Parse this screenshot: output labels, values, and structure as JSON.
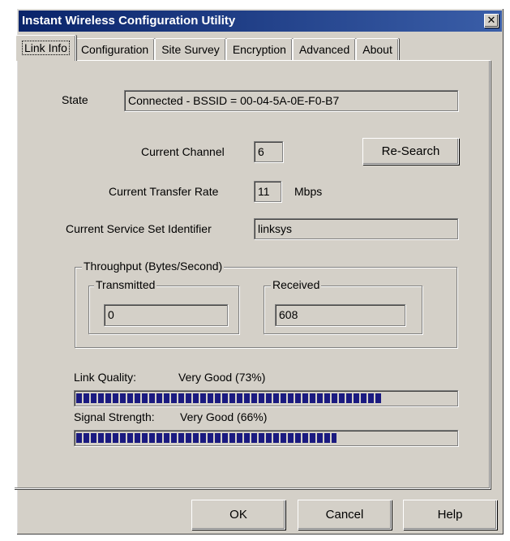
{
  "window": {
    "title": "Instant Wireless Configuration Utility",
    "close_glyph": "✕"
  },
  "tabs": [
    {
      "label": "Link Info",
      "active": true
    },
    {
      "label": "Configuration",
      "active": false
    },
    {
      "label": "Site Survey",
      "active": false
    },
    {
      "label": "Encryption",
      "active": false
    },
    {
      "label": "Advanced",
      "active": false
    },
    {
      "label": "About",
      "active": false
    }
  ],
  "link_info": {
    "state_label": "State",
    "state_value": "Connected - BSSID = 00-04-5A-0E-F0-B7",
    "channel_label": "Current Channel",
    "channel_value": "6",
    "research_button": "Re-Search",
    "rate_label": "Current Transfer Rate",
    "rate_value": "11",
    "rate_unit": "Mbps",
    "ssid_label": "Current Service Set Identifier",
    "ssid_value": "linksys",
    "throughput": {
      "title": "Throughput (Bytes/Second)",
      "transmitted_label": "Transmitted",
      "transmitted_value": "0",
      "received_label": "Received",
      "received_value": "608"
    },
    "link_quality": {
      "label": "Link Quality:",
      "value_text": "Very Good (73%)",
      "percent": 73
    },
    "signal_strength": {
      "label": "Signal Strength:",
      "value_text": "Very Good (66%)",
      "percent": 66
    }
  },
  "footer": {
    "ok_label": "OK",
    "cancel_label": "Cancel",
    "help_label": "Help"
  },
  "colors": {
    "titlebar": "#0a246a",
    "face": "#d4d0c8",
    "bar_fill": "#1a1a80"
  },
  "icons": {
    "close": "close-icon"
  }
}
